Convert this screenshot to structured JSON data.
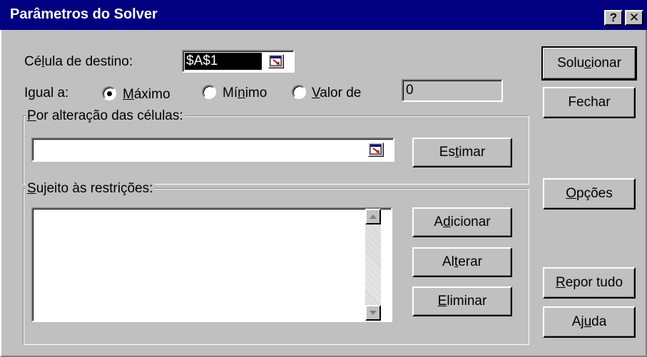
{
  "window": {
    "title": "Parâmetros do Solver",
    "help_button": "?",
    "close_button": "✕"
  },
  "target_cell": {
    "label_pre": "Cé",
    "label_key": "l",
    "label_post": "ula de destino:",
    "value": "$A$1"
  },
  "equal_to": {
    "label": "Igual a:",
    "options": [
      {
        "pre": "",
        "key": "M",
        "post": "áximo",
        "selected": true
      },
      {
        "pre": "Mí",
        "key": "n",
        "post": "imo",
        "selected": false
      },
      {
        "pre": "",
        "key": "V",
        "post": "alor de",
        "selected": false
      }
    ],
    "value_of": "0"
  },
  "changing_cells": {
    "label_pre": "",
    "label_key": "P",
    "label_post": "or alteração das células:",
    "value": ""
  },
  "constraints": {
    "label_pre": "",
    "label_key": "S",
    "label_post": "ujeito às restrições:",
    "items": []
  },
  "buttons": {
    "solve": {
      "pre": "Solu",
      "key": "c",
      "post": "ionar"
    },
    "close": {
      "pre": "Fechar",
      "key": "",
      "post": ""
    },
    "guess": {
      "pre": "Es",
      "key": "t",
      "post": "imar"
    },
    "options": {
      "pre": "",
      "key": "O",
      "post": "pções"
    },
    "add": {
      "pre": "A",
      "key": "d",
      "post": "icionar"
    },
    "change": {
      "pre": "Al",
      "key": "t",
      "post": "erar"
    },
    "delete": {
      "pre": "",
      "key": "E",
      "post": "liminar"
    },
    "reset": {
      "pre": "",
      "key": "R",
      "post": "epor tudo"
    },
    "help": {
      "pre": "Aj",
      "key": "u",
      "post": "da"
    }
  }
}
